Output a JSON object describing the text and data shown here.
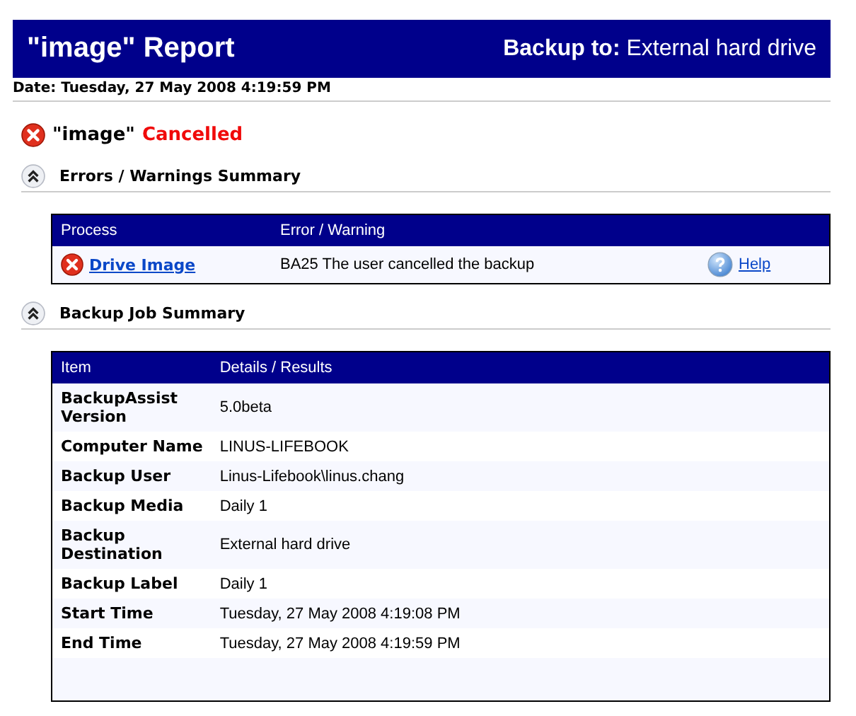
{
  "header": {
    "title": "\"image\" Report",
    "backup_to": "**Backup to:** External hard drive"
  },
  "date": "Date: Tuesday, 27 May 2008 4:19:59 PM",
  "status": {
    "name": "\"image\"",
    "result": "Cancelled"
  },
  "sections": [
    {
      "title": "Errors / Warnings Summary",
      "expanded": true,
      "kind": "errors",
      "columns": [
        "Process",
        "Error / Warning"
      ],
      "rows": [
        {
          "process": "Drive Image",
          "message": "BA25 The user cancelled the backup",
          "help": "Help"
        }
      ]
    },
    {
      "title": "Backup Job Summary",
      "expanded": true,
      "kind": "summary",
      "columns": [
        "Item",
        "Details / Results"
      ],
      "rows": [
        {
          "item": "BackupAssist Version",
          "value": "5.0beta"
        },
        {
          "item": "Computer Name",
          "value": "LINUS-LIFEBOOK"
        },
        {
          "item": "Backup User",
          "value": "Linus-Lifebook\\linus.chang"
        },
        {
          "item": "Backup Media",
          "value": "Daily 1"
        },
        {
          "item": "Backup Destination",
          "value": "External hard drive"
        },
        {
          "item": "Backup Label",
          "value": "Daily 1"
        },
        {
          "item": "Start Time",
          "value": "Tuesday, 27 May 2008 4:19:08 PM"
        },
        {
          "item": "End Time",
          "value": "Tuesday, 27 May 2008 4:19:59 PM"
        }
      ]
    }
  ]
}
